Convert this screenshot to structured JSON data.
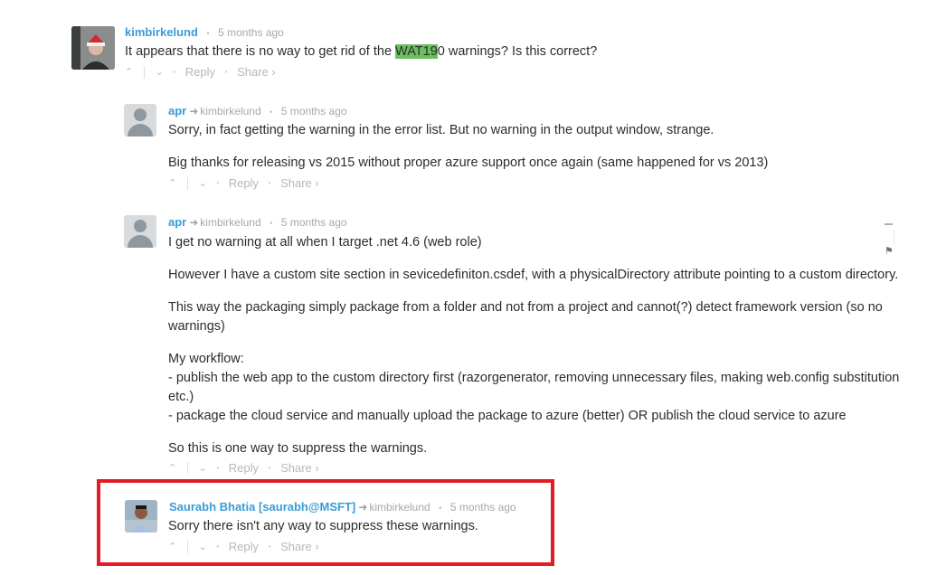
{
  "comments": [
    {
      "author": "kimbirkelund",
      "reply_to": "",
      "time": "5 months ago",
      "avatar": "user-photo-avatar",
      "paragraphs": [],
      "message_parts": {
        "before": "It appears that there is no way to get rid of the ",
        "highlight": "WAT19",
        "after": "0 warnings? Is this correct?"
      },
      "actions": {
        "upvote": "^",
        "downvote": "v",
        "reply": "Reply",
        "share": "Share ›"
      }
    },
    {
      "author": "apr",
      "reply_to": "kimbirkelund",
      "time": "5 months ago",
      "avatar": "default-avatar",
      "paragraphs": [
        "Sorry, in fact getting the warning in the error list. But no warning in the output window, strange.",
        "Big thanks for releasing vs 2015 without proper azure support once again (same happened for vs 2013)"
      ],
      "actions": {
        "reply": "Reply",
        "share": "Share ›"
      }
    },
    {
      "author": "apr",
      "reply_to": "kimbirkelund",
      "time": "5 months ago",
      "avatar": "default-avatar",
      "paragraphs": [
        "I get no warning at all when I target .net 4.6 (web role)",
        "However I have a custom site section in sevicedefiniton.csdef, with a physicalDirectory attribute pointing to a custom directory.",
        "This way the packaging simply package from a folder and not from a project and cannot(?) detect framework version (so no warnings)",
        "My workflow:\n- publish the web app to the custom directory first (razorgenerator, removing unnecessary files, making web.config substitution etc.)\n- package the cloud service and manually upload the package to azure (better) OR publish the cloud service to azure",
        "So this is one way to suppress the warnings."
      ],
      "actions": {
        "reply": "Reply",
        "share": "Share ›"
      },
      "tools": {
        "collapse": "—",
        "flag": "flag"
      }
    },
    {
      "author": "Saurabh Bhatia [saurabh@MSFT]",
      "reply_to": "kimbirkelund",
      "time": "5 months ago",
      "avatar": "user-photo-avatar",
      "paragraphs": [
        "Sorry there isn't any way to suppress these warnings."
      ],
      "actions": {
        "reply": "Reply",
        "share": "Share ›"
      },
      "highlighted": true
    }
  ],
  "colors": {
    "author": "#3a9bd5",
    "highlight": "#6dbf5e",
    "annotation_box": "#e21b24"
  }
}
